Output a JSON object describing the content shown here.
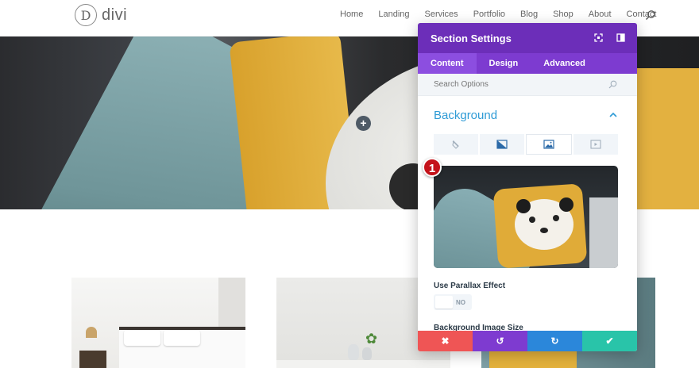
{
  "header": {
    "logo_mark": "D",
    "logo_text": "divi",
    "nav": [
      "Home",
      "Landing",
      "Services",
      "Portfolio",
      "Blog",
      "Shop",
      "About",
      "Contact"
    ]
  },
  "hero": {
    "add_label": "+"
  },
  "panel": {
    "title": "Section Settings",
    "tabs": [
      {
        "label": "Content",
        "active": true
      },
      {
        "label": "Design",
        "active": false
      },
      {
        "label": "Advanced",
        "active": false
      }
    ],
    "search_placeholder": "Search Options",
    "section_title": "Background",
    "background_types": [
      {
        "icon": "color-fill-icon",
        "active": false
      },
      {
        "icon": "gradient-icon",
        "active": false
      },
      {
        "icon": "image-icon",
        "active": true
      },
      {
        "icon": "video-icon",
        "active": false
      }
    ],
    "parallax_label": "Use Parallax Effect",
    "parallax_value": "NO",
    "size_label": "Background Image Size",
    "footer": {
      "cancel": "✖",
      "undo": "↺",
      "redo": "↻",
      "save": "✔"
    }
  },
  "callout": "1",
  "colors": {
    "panel_header": "#6c2eb9",
    "panel_tabs": "#7d3bd0",
    "section_title": "#2e9bd6",
    "cancel": "#ef5555",
    "undo": "#7e3bd0",
    "redo": "#2b87da",
    "save": "#29c4a9",
    "callout": "#c4121a"
  }
}
